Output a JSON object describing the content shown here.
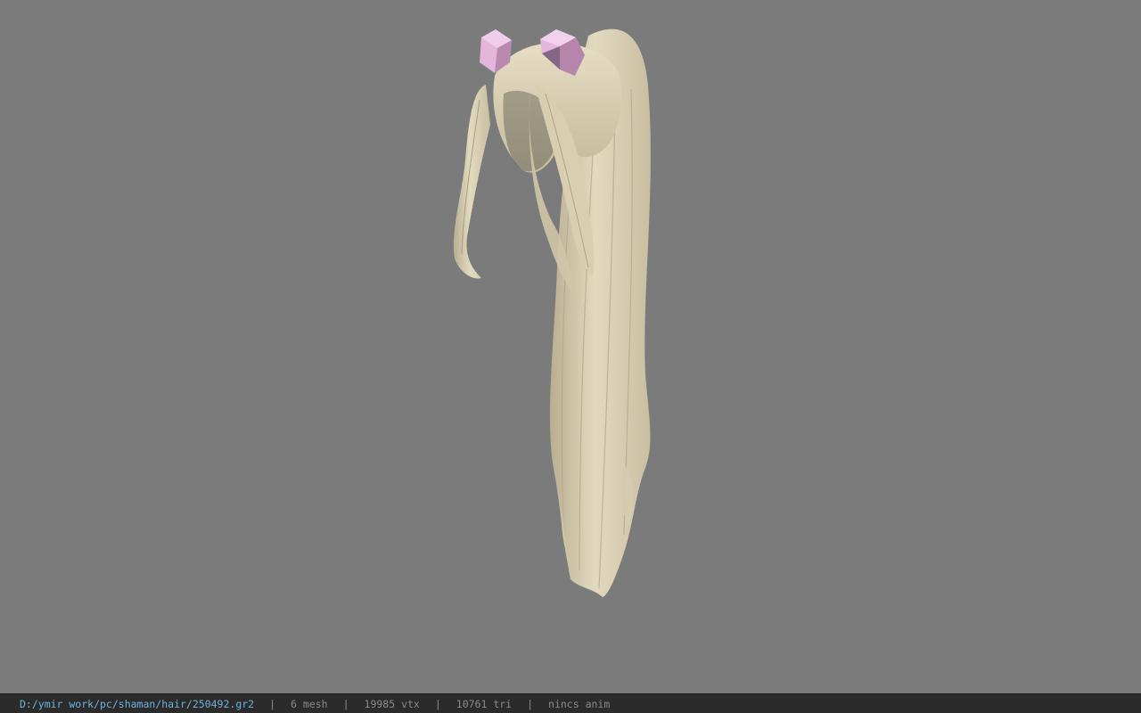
{
  "status_bar": {
    "file_path": "D:/ymir work/pc/shaman/hair/250492.gr2",
    "separator": "|",
    "mesh_count": "6 mesh",
    "vertex_count": "19985 vtx",
    "triangle_count": "10761 tri",
    "anim_status": "nincs anim"
  },
  "colors": {
    "viewport_background": "#7b7b7b",
    "status_bar_background": "#2b2b2b",
    "path_text": "#6fb3d9",
    "info_text": "#8a8a8a",
    "hair": "#dcd3b8",
    "hair_shadow": "#b9ae92",
    "hair_accessory": "#e4b6dc"
  },
  "model": {
    "type": "3d-hair-mesh",
    "accessory_icon": "pink-hair-ornament"
  }
}
